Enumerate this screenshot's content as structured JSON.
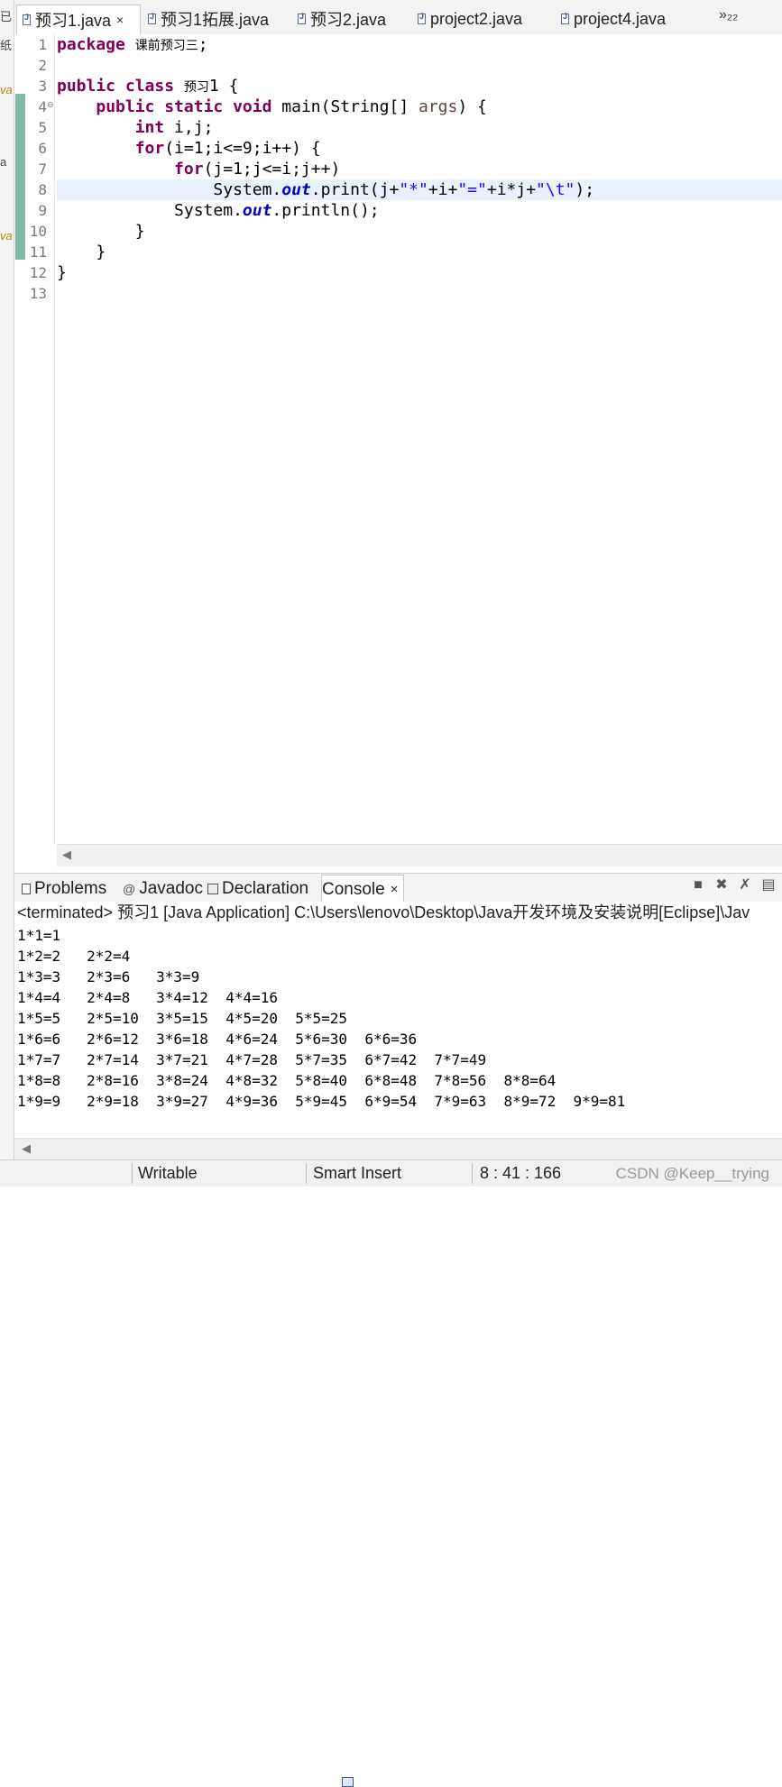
{
  "left_strip": {
    "fragments": [
      "已",
      "纸",
      "va",
      "a",
      "va"
    ]
  },
  "editor_tabs": [
    {
      "label": "预习1.java",
      "close": "×"
    },
    {
      "label": "预习1拓展.java"
    },
    {
      "label": "预习2.java"
    },
    {
      "label": "project2.java"
    },
    {
      "label": "project4.java"
    }
  ],
  "tab_overflow": "»₂₂",
  "code": {
    "line_numbers": [
      "1",
      "2",
      "3",
      "4",
      "5",
      "6",
      "7",
      "8",
      "9",
      "10",
      "11",
      "12",
      "13"
    ],
    "fold_marker": "⊖",
    "l1_kw": "package",
    "l1_pkg": "课前预习三",
    "l1_end": ";",
    "l3_kw": "public class",
    "l3_name": "预习",
    "l3_rest": "1 {",
    "l4_kw": "public static void",
    "l4_a": " main(String[] ",
    "l4_var": "args",
    "l4_b": ") {",
    "l5_kw": "int",
    "l5_rest": " i,j;",
    "l6_kw": "for",
    "l6_rest": "(i=1;i<=9;i++) {",
    "l7_kw": "for",
    "l7_rest": "(j=1;j<=i;j++)",
    "l8_a": "System.",
    "l8_out": "out",
    "l8_b": ".print(j+",
    "l8_s1": "\"*\"",
    "l8_c": "+i+",
    "l8_s2": "\"=\"",
    "l8_d": "+i*j+",
    "l8_s3": "\"\\t\"",
    "l8_e": ");",
    "l9_a": "System.",
    "l9_out": "out",
    "l9_b": ".println();",
    "l10": "}",
    "l11": "}",
    "l12": "}"
  },
  "view_tabs": [
    {
      "label": "Problems",
      "icon": "problems-icon"
    },
    {
      "label": "Javadoc",
      "icon": "javadoc-icon"
    },
    {
      "label": "Declaration",
      "icon": "declaration-icon"
    },
    {
      "label": "Console",
      "icon": "console-icon",
      "close": "×"
    }
  ],
  "console": {
    "header": "<terminated> 预习1 [Java Application] C:\\Users\\lenovo\\Desktop\\Java开发环境及安装说明[Eclipse]\\Jav",
    "lines": [
      "1*1=1",
      "1*2=2   2*2=4",
      "1*3=3   2*3=6   3*3=9",
      "1*4=4   2*4=8   3*4=12  4*4=16",
      "1*5=5   2*5=10  3*5=15  4*5=20  5*5=25",
      "1*6=6   2*6=12  3*6=18  4*6=24  5*6=30  6*6=36",
      "1*7=7   2*7=14  3*7=21  4*7=28  5*7=35  6*7=42  7*7=49",
      "1*8=8   2*8=16  3*8=24  4*8=32  5*8=40  6*8=48  7*8=56  8*8=64",
      "1*9=9   2*9=18  3*9=27  4*9=36  5*9=45  6*9=54  7*9=63  8*9=72  9*9=81"
    ]
  },
  "status": {
    "writable": "Writable",
    "insert_mode": "Smart Insert",
    "position": "8 : 41 : 166",
    "watermark": "CSDN @Keep__trying"
  },
  "colors": {
    "keyword": "#7f0055",
    "string": "#2a00ff",
    "field": "#0000c0",
    "current_line": "#e8f2fe",
    "change_bar": "#7fb9a8"
  }
}
